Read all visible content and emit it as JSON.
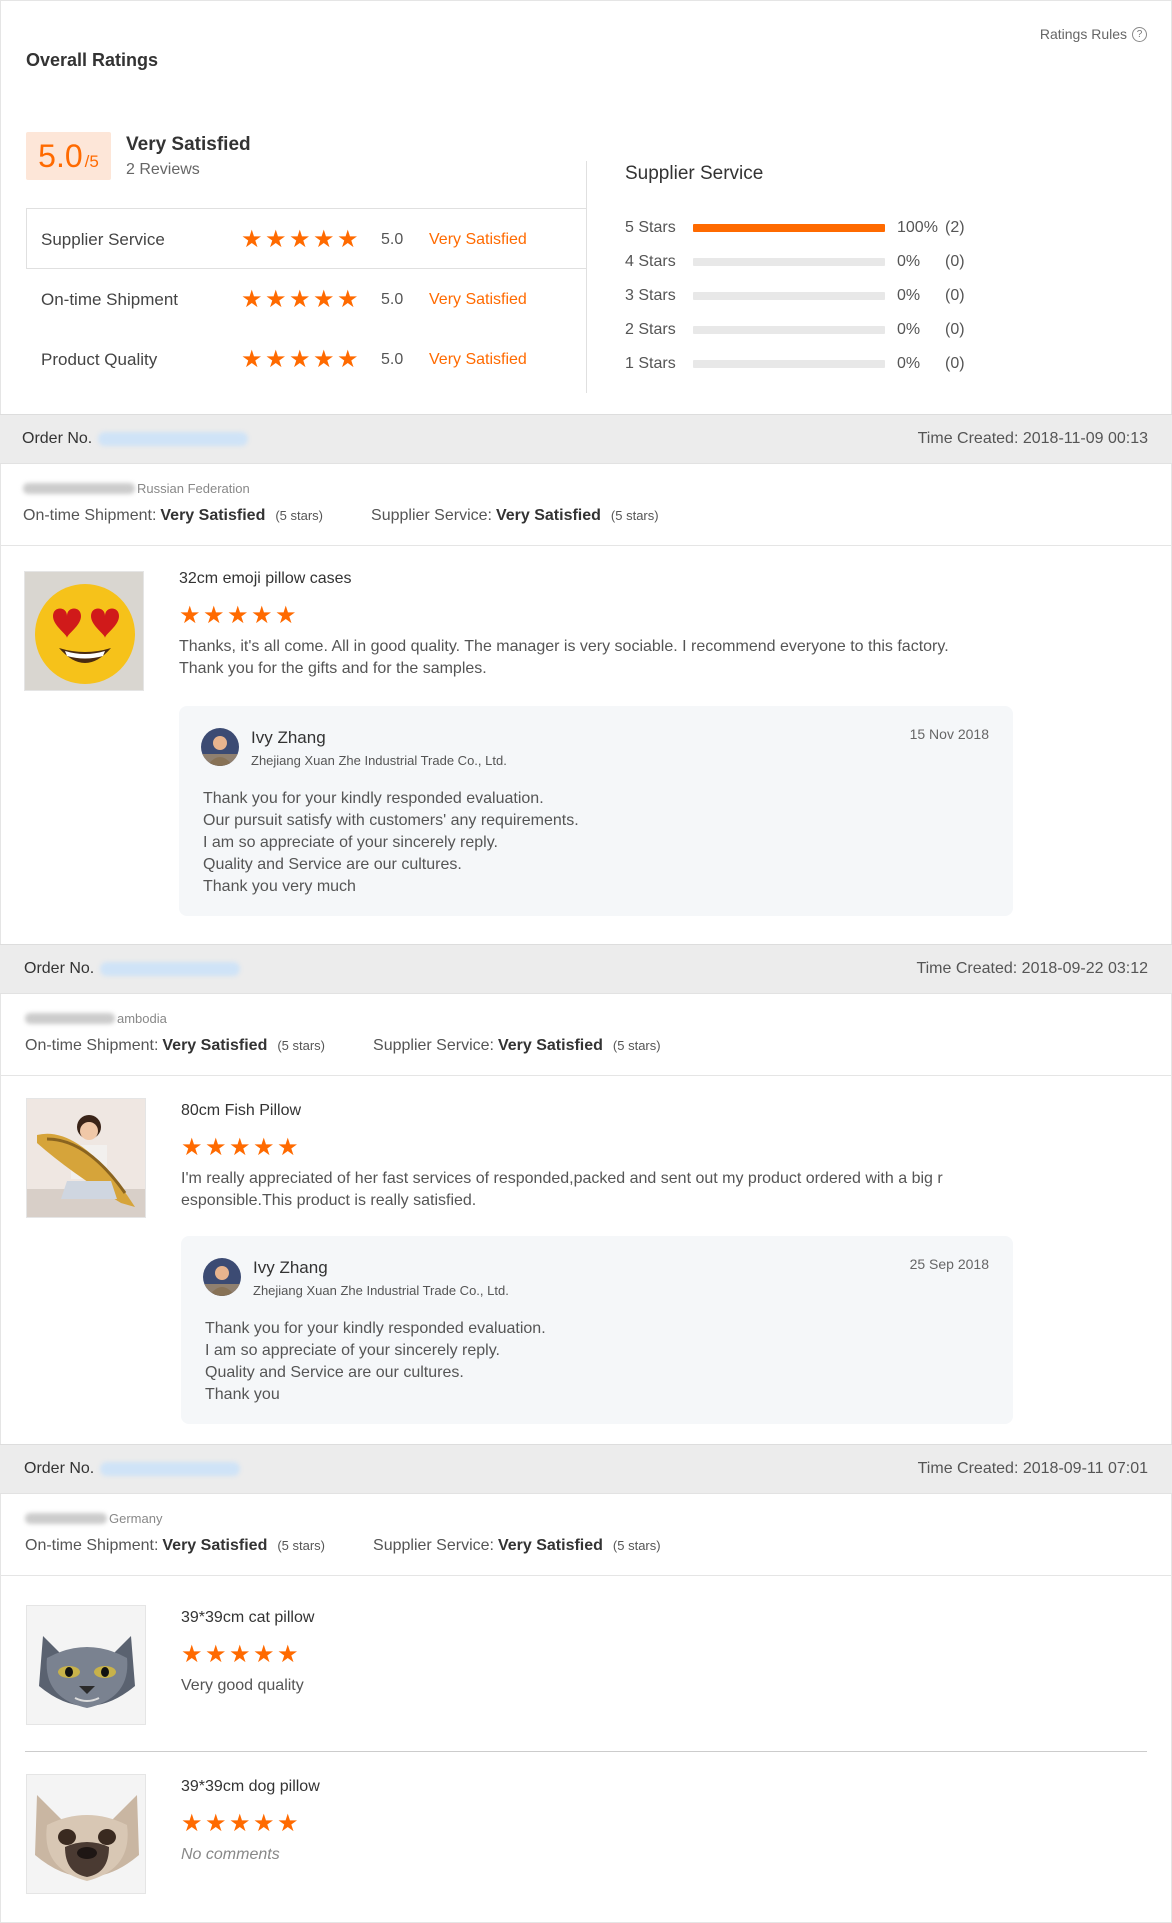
{
  "overall": {
    "title": "Overall Ratings",
    "rules_label": "Ratings Rules",
    "score": "5.0",
    "score_max": "/5",
    "level": "Very Satisfied",
    "reviews": "2 Reviews",
    "dimensions": [
      {
        "name": "Supplier Service",
        "rating": 5,
        "score": "5.0",
        "level": "Very Satisfied"
      },
      {
        "name": "On-time Shipment",
        "rating": 5,
        "score": "5.0",
        "level": "Very Satisfied"
      },
      {
        "name": "Product Quality",
        "rating": 5,
        "score": "5.0",
        "level": "Very Satisfied"
      }
    ]
  },
  "supplier_service": {
    "title": "Supplier Service",
    "distribution": [
      {
        "label": "5  Stars",
        "fraction": 1.0,
        "pct": "100%",
        "count": "(2)"
      },
      {
        "label": "4  Stars",
        "fraction": 0,
        "pct": "0%",
        "count": "(0)"
      },
      {
        "label": "3  Stars",
        "fraction": 0,
        "pct": "0%",
        "count": "(0)"
      },
      {
        "label": "2  Stars",
        "fraction": 0,
        "pct": "0%",
        "count": "(0)"
      },
      {
        "label": "1  Stars",
        "fraction": 0,
        "pct": "0%",
        "count": "(0)"
      }
    ]
  },
  "labels": {
    "order_no": "Order No.",
    "time_created": "Time Created:",
    "on_time": "On-time Shipment:",
    "supplier_service": "Supplier Service:",
    "very_satisfied": "Very Satisfied",
    "five_stars": "(5 stars)"
  },
  "colors": {
    "accent": "#ff6a00",
    "header_bg": "#ececec",
    "reply_bg": "#f5f7f9"
  },
  "orders": [
    {
      "time": "2018-11-09 00:13",
      "country": "Russian Federation",
      "products": [
        {
          "title": "32cm emoji pillow cases",
          "rating": 5,
          "icon": "emoji-heart-eyes-pillow-image",
          "text": [
            "Thanks, it's all come. All in good quality. The manager is very sociable. I recommend everyone to this factory.",
            "Thank you for the gifts and for the samples."
          ]
        }
      ],
      "reply": {
        "name": "Ivy Zhang",
        "company": "Zhejiang Xuan Zhe Industrial Trade Co., Ltd.",
        "date": "15 Nov 2018",
        "lines": [
          "Thank you for your kindly responded evaluation.",
          "Our pursuit satisfy with customers' any requirements.",
          "I am so appreciate of your sincerely  reply.",
          "Quality and Service are our cultures.",
          "Thank you very much"
        ]
      }
    },
    {
      "time": "2018-09-22 03:12",
      "country": "ambodia",
      "products": [
        {
          "title": "80cm Fish Pillow",
          "rating": 5,
          "icon": "fish-pillow-photo",
          "text": [
            "I'm really appreciated of her fast services of responded,packed and sent out my product ordered with a big r",
            "esponsible.This product is really satisfied."
          ]
        }
      ],
      "reply": {
        "name": "Ivy Zhang",
        "company": "Zhejiang Xuan Zhe Industrial Trade Co., Ltd.",
        "date": "25 Sep 2018",
        "lines": [
          "Thank you for your kindly responded evaluation.",
          "I am so appreciate of your sincerely  reply.",
          "Quality and Service are our cultures.",
          "Thank you"
        ]
      }
    },
    {
      "time": "2018-09-11 07:01",
      "country": "Germany",
      "products": [
        {
          "title": "39*39cm cat pillow",
          "rating": 5,
          "icon": "cat-pillow-image",
          "text": [
            "Very good quality"
          ]
        },
        {
          "title": "39*39cm dog pillow",
          "rating": 5,
          "icon": "dog-pillow-image",
          "text": [
            "No comments"
          ]
        }
      ]
    }
  ]
}
